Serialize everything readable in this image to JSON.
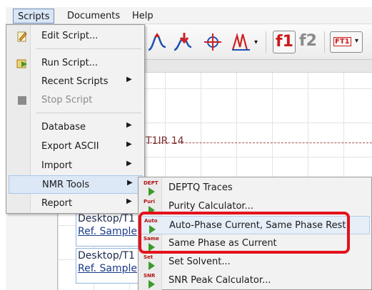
{
  "menubar": {
    "items": [
      "Scripts",
      "Documents",
      "Help"
    ]
  },
  "toolbar": {
    "f1_label": "f1",
    "f2_label": "f2",
    "fn_label": "FT1"
  },
  "document": {
    "spectrum_label": "T1IR 14",
    "entries": [
      {
        "path": "Desktop/T1",
        "ref": "Ref. Sample"
      },
      {
        "path": "Desktop/T1",
        "ref": "Ref. Sample"
      }
    ]
  },
  "scripts_menu": {
    "edit_script": "Edit Script...",
    "run_script": "Run Script...",
    "recent_scripts": "Recent Scripts",
    "stop_script": "Stop Script",
    "database": "Database",
    "export_ascii": "Export ASCII",
    "import": "Import",
    "nmr_tools": "NMR Tools",
    "report": "Report",
    "submenu_arrow": "▶"
  },
  "nmr_tools_menu": {
    "items": [
      {
        "label": "DEPTQ Traces",
        "icon_tag": "DEPT"
      },
      {
        "label": "Purity Calculator...",
        "icon_tag": "Puri"
      },
      {
        "label": "Auto-Phase Current, Same Phase Rest",
        "icon_tag": "Auto"
      },
      {
        "label": "Same Phase as Current",
        "icon_tag": "Same"
      },
      {
        "label": "Set Solvent...",
        "icon_tag": "Set"
      },
      {
        "label": "SNR Peak Calculator...",
        "icon_tag": "SNR"
      }
    ]
  },
  "colors": {
    "highlight_border": "#e3121c",
    "menu_hover": "#dce8f6",
    "accent_red": "#cc1b1b",
    "play_green": "#3a9a2a"
  }
}
